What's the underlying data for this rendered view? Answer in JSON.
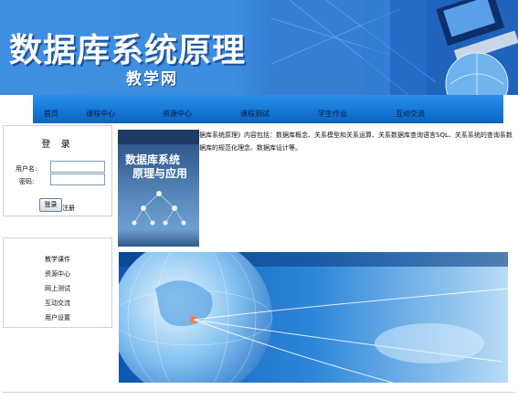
{
  "header": {
    "title": "数据库系统原理",
    "subtitle": "教学网"
  },
  "nav": {
    "items": [
      {
        "label": "首页"
      },
      {
        "label": "课程中心"
      },
      {
        "label": "资源中心"
      },
      {
        "label": "课程测试"
      },
      {
        "label": "学生作业"
      },
      {
        "label": "互动交流"
      }
    ]
  },
  "login": {
    "title": "登 录",
    "username_label": "用户名:",
    "password_label": "密码:",
    "username_value": "",
    "password_value": "",
    "login_button": "登录",
    "register_link": "注册"
  },
  "side_menu": {
    "items": [
      {
        "label": "教学课件"
      },
      {
        "label": "资源中心"
      },
      {
        "label": "网上测试"
      },
      {
        "label": "互动交流"
      },
      {
        "label": "用户设置"
      }
    ]
  },
  "main": {
    "book": {
      "title_line1": "数据库系统",
      "title_line2": "原理与应用"
    },
    "description": "据库系统原理》内容包括：数据库概念、关系模型和关系运算、关系数据库查询语言SQL、关系系统的查询系数据库的规范化理念、数据库设计等。"
  },
  "colors": {
    "banner_blue": "#3f8fe0",
    "nav_blue": "#1478d8",
    "border": "#c9d3df"
  }
}
